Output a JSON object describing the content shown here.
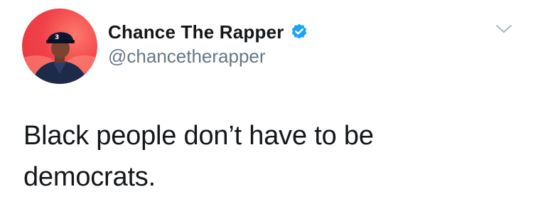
{
  "tweet": {
    "author": {
      "display_name": "Chance The Rapper",
      "handle": "@chancetherapper",
      "verified": true,
      "avatar_icon": "avatar-image",
      "cap_number": "3"
    },
    "text": "Black people don’t have to be\ndemocrats.",
    "menu_icon": "chevron-down-icon"
  },
  "colors": {
    "verified_blue": "#1da1f2",
    "handle_gray": "#657786",
    "text_dark": "#14171a",
    "avatar_red": "#e8333c"
  }
}
